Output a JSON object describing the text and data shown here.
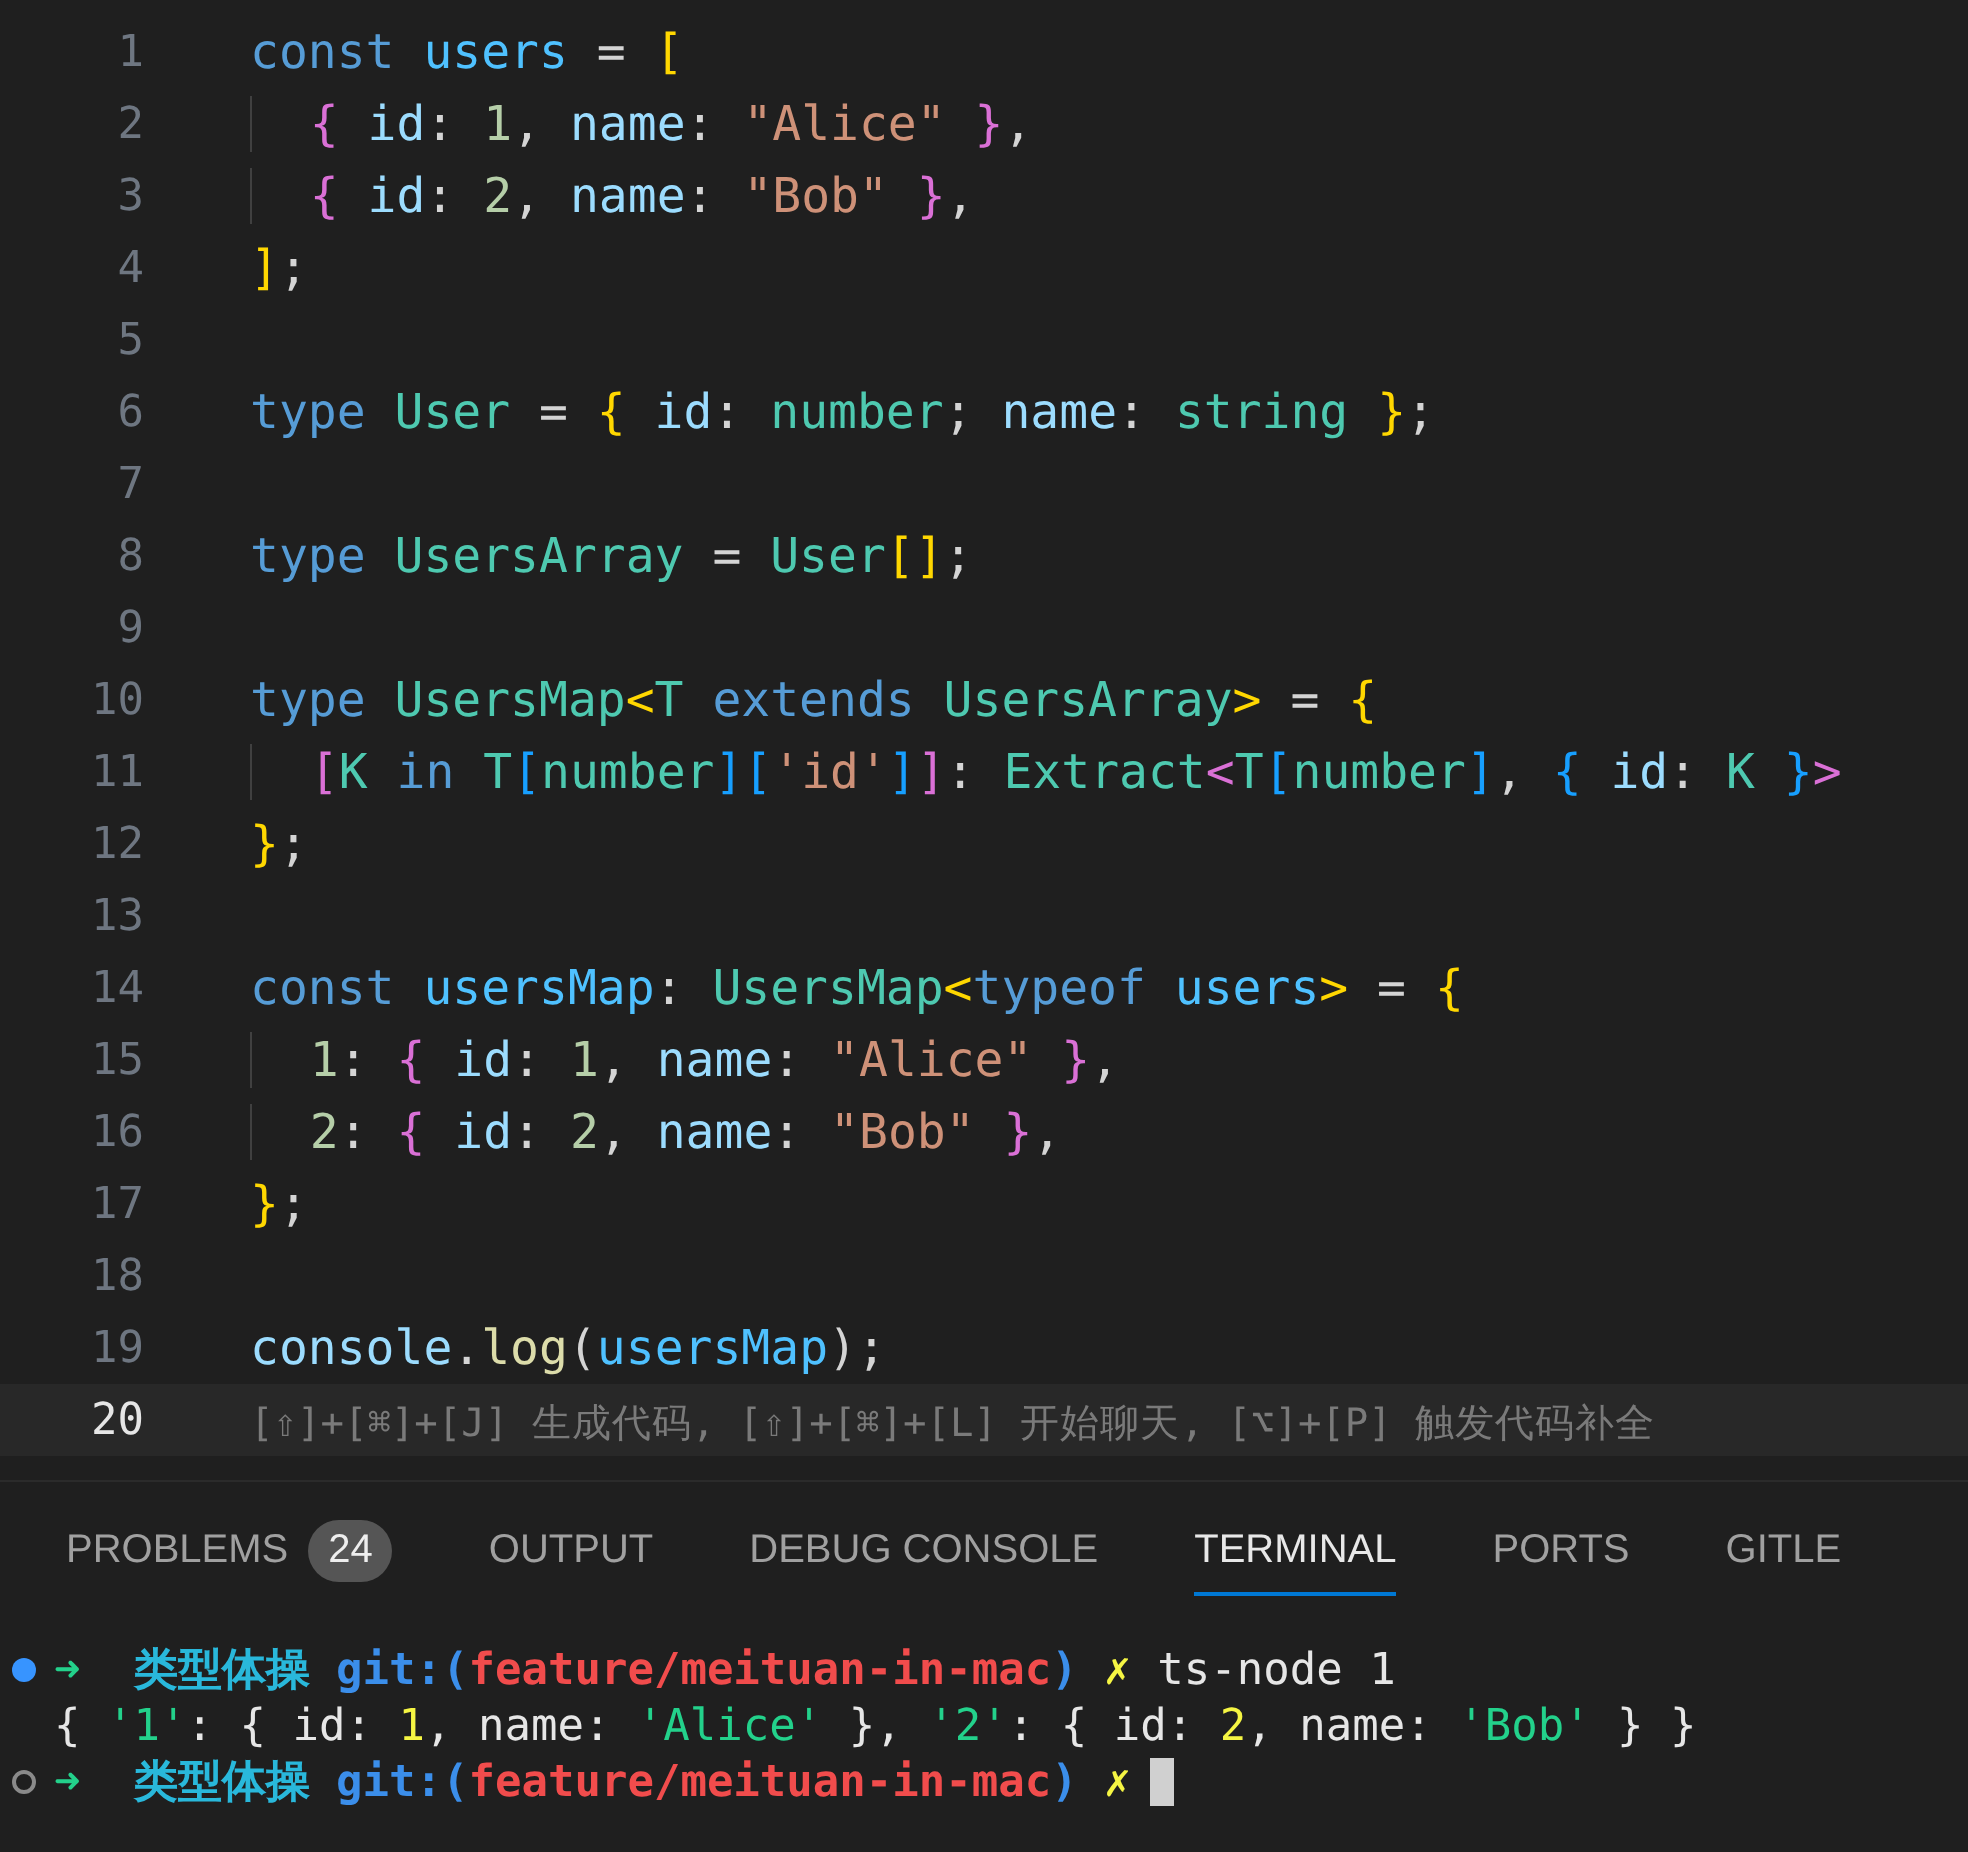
{
  "editor": {
    "lines": [
      {
        "number": "1",
        "current": false,
        "tokens": [
          {
            "text": "const ",
            "kind": "kw"
          },
          {
            "text": "users",
            "kind": "var"
          },
          {
            "text": " = ",
            "kind": "p"
          },
          {
            "text": "[",
            "kind": "b1"
          }
        ]
      },
      {
        "number": "2",
        "current": false,
        "guide": true,
        "tokens": [
          {
            "text": "{",
            "kind": "b2"
          },
          {
            "text": " id",
            "kind": "prop"
          },
          {
            "text": ": ",
            "kind": "p"
          },
          {
            "text": "1",
            "kind": "num"
          },
          {
            "text": ", ",
            "kind": "p"
          },
          {
            "text": "name",
            "kind": "prop"
          },
          {
            "text": ": ",
            "kind": "p"
          },
          {
            "text": "\"Alice\"",
            "kind": "str"
          },
          {
            "text": " }",
            "kind": "b2"
          },
          {
            "text": ",",
            "kind": "p"
          }
        ]
      },
      {
        "number": "3",
        "current": false,
        "guide": true,
        "tokens": [
          {
            "text": "{",
            "kind": "b2"
          },
          {
            "text": " id",
            "kind": "prop"
          },
          {
            "text": ": ",
            "kind": "p"
          },
          {
            "text": "2",
            "kind": "num"
          },
          {
            "text": ", ",
            "kind": "p"
          },
          {
            "text": "name",
            "kind": "prop"
          },
          {
            "text": ": ",
            "kind": "p"
          },
          {
            "text": "\"Bob\"",
            "kind": "str"
          },
          {
            "text": " }",
            "kind": "b2"
          },
          {
            "text": ",",
            "kind": "p"
          }
        ]
      },
      {
        "number": "4",
        "current": false,
        "tokens": [
          {
            "text": "]",
            "kind": "b1"
          },
          {
            "text": ";",
            "kind": "p"
          }
        ]
      },
      {
        "number": "5",
        "current": false
      },
      {
        "number": "6",
        "current": false,
        "tokens": [
          {
            "text": "type ",
            "kind": "kw"
          },
          {
            "text": "User",
            "kind": "type"
          },
          {
            "text": " = ",
            "kind": "p"
          },
          {
            "text": "{",
            "kind": "b1"
          },
          {
            "text": " id",
            "kind": "prop"
          },
          {
            "text": ": ",
            "kind": "p"
          },
          {
            "text": "number",
            "kind": "type"
          },
          {
            "text": "; ",
            "kind": "p"
          },
          {
            "text": "name",
            "kind": "prop"
          },
          {
            "text": ": ",
            "kind": "p"
          },
          {
            "text": "string",
            "kind": "type"
          },
          {
            "text": " }",
            "kind": "b1"
          },
          {
            "text": ";",
            "kind": "p"
          }
        ]
      },
      {
        "number": "7",
        "current": false
      },
      {
        "number": "8",
        "current": false,
        "tokens": [
          {
            "text": "type ",
            "kind": "kw"
          },
          {
            "text": "UsersArray",
            "kind": "type"
          },
          {
            "text": " = ",
            "kind": "p"
          },
          {
            "text": "User",
            "kind": "type"
          },
          {
            "text": "[]",
            "kind": "b1"
          },
          {
            "text": ";",
            "kind": "p"
          }
        ]
      },
      {
        "number": "9",
        "current": false
      },
      {
        "number": "10",
        "current": false,
        "tokens": [
          {
            "text": "type ",
            "kind": "kw"
          },
          {
            "text": "UsersMap",
            "kind": "type"
          },
          {
            "text": "<",
            "kind": "b1"
          },
          {
            "text": "T",
            "kind": "type"
          },
          {
            "text": " extends ",
            "kind": "kw"
          },
          {
            "text": "UsersArray",
            "kind": "type"
          },
          {
            "text": ">",
            "kind": "b1"
          },
          {
            "text": " = ",
            "kind": "p"
          },
          {
            "text": "{",
            "kind": "b1"
          }
        ]
      },
      {
        "number": "11",
        "current": false,
        "guide": true,
        "tokens": [
          {
            "text": "[",
            "kind": "b2"
          },
          {
            "text": "K",
            "kind": "type"
          },
          {
            "text": " in ",
            "kind": "kw"
          },
          {
            "text": "T",
            "kind": "type"
          },
          {
            "text": "[",
            "kind": "b3"
          },
          {
            "text": "number",
            "kind": "type"
          },
          {
            "text": "]",
            "kind": "b3"
          },
          {
            "text": "[",
            "kind": "b3"
          },
          {
            "text": "'id'",
            "kind": "str"
          },
          {
            "text": "]",
            "kind": "b3"
          },
          {
            "text": "]",
            "kind": "b2"
          },
          {
            "text": ": ",
            "kind": "p"
          },
          {
            "text": "Extract",
            "kind": "type"
          },
          {
            "text": "<",
            "kind": "b2"
          },
          {
            "text": "T",
            "kind": "type"
          },
          {
            "text": "[",
            "kind": "b3"
          },
          {
            "text": "number",
            "kind": "type"
          },
          {
            "text": "]",
            "kind": "b3"
          },
          {
            "text": ", ",
            "kind": "p"
          },
          {
            "text": "{",
            "kind": "b3"
          },
          {
            "text": " id",
            "kind": "prop"
          },
          {
            "text": ": ",
            "kind": "p"
          },
          {
            "text": "K",
            "kind": "type"
          },
          {
            "text": " }",
            "kind": "b3"
          },
          {
            "text": ">",
            "kind": "b2"
          }
        ]
      },
      {
        "number": "12",
        "current": false,
        "tokens": [
          {
            "text": "}",
            "kind": "b1"
          },
          {
            "text": ";",
            "kind": "p"
          }
        ]
      },
      {
        "number": "13",
        "current": false
      },
      {
        "number": "14",
        "current": false,
        "tokens": [
          {
            "text": "const ",
            "kind": "kw"
          },
          {
            "text": "usersMap",
            "kind": "var"
          },
          {
            "text": ": ",
            "kind": "p"
          },
          {
            "text": "UsersMap",
            "kind": "type"
          },
          {
            "text": "<",
            "kind": "b1"
          },
          {
            "text": "typeof ",
            "kind": "kw"
          },
          {
            "text": "users",
            "kind": "var"
          },
          {
            "text": ">",
            "kind": "b1"
          },
          {
            "text": " = ",
            "kind": "p"
          },
          {
            "text": "{",
            "kind": "b1"
          }
        ]
      },
      {
        "number": "15",
        "current": false,
        "guide": true,
        "tokens": [
          {
            "text": "1",
            "kind": "num"
          },
          {
            "text": ": ",
            "kind": "p"
          },
          {
            "text": "{",
            "kind": "b2"
          },
          {
            "text": " id",
            "kind": "prop"
          },
          {
            "text": ": ",
            "kind": "p"
          },
          {
            "text": "1",
            "kind": "num"
          },
          {
            "text": ", ",
            "kind": "p"
          },
          {
            "text": "name",
            "kind": "prop"
          },
          {
            "text": ": ",
            "kind": "p"
          },
          {
            "text": "\"Alice\"",
            "kind": "str"
          },
          {
            "text": " }",
            "kind": "b2"
          },
          {
            "text": ",",
            "kind": "p"
          }
        ]
      },
      {
        "number": "16",
        "current": false,
        "guide": true,
        "tokens": [
          {
            "text": "2",
            "kind": "num"
          },
          {
            "text": ": ",
            "kind": "p"
          },
          {
            "text": "{",
            "kind": "b2"
          },
          {
            "text": " id",
            "kind": "prop"
          },
          {
            "text": ": ",
            "kind": "p"
          },
          {
            "text": "2",
            "kind": "num"
          },
          {
            "text": ", ",
            "kind": "p"
          },
          {
            "text": "name",
            "kind": "prop"
          },
          {
            "text": ": ",
            "kind": "p"
          },
          {
            "text": "\"Bob\"",
            "kind": "str"
          },
          {
            "text": " }",
            "kind": "b2"
          },
          {
            "text": ",",
            "kind": "p"
          }
        ]
      },
      {
        "number": "17",
        "current": false,
        "tokens": [
          {
            "text": "}",
            "kind": "b1"
          },
          {
            "text": ";",
            "kind": "p"
          }
        ]
      },
      {
        "number": "18",
        "current": false
      },
      {
        "number": "19",
        "current": false,
        "tokens": [
          {
            "text": "console",
            "kind": "prop"
          },
          {
            "text": ".",
            "kind": "p"
          },
          {
            "text": "log",
            "kind": "fn"
          },
          {
            "text": "(",
            "kind": "p"
          },
          {
            "text": "usersMap",
            "kind": "var"
          },
          {
            "text": ")",
            "kind": "p"
          },
          {
            "text": ";",
            "kind": "p"
          }
        ]
      },
      {
        "number": "20",
        "current": true,
        "tokens": [
          {
            "text": "[⇧]+[⌘]+[J] 生成代码, [⇧]+[⌘]+[L] 开始聊天, [⌥]+[P] 触发代码补全",
            "kind": "hint"
          }
        ]
      }
    ]
  },
  "panel": {
    "tabs": [
      {
        "label": "PROBLEMS",
        "selected": false,
        "badge": "24"
      },
      {
        "label": "OUTPUT",
        "selected": false
      },
      {
        "label": "DEBUG CONSOLE",
        "selected": false
      },
      {
        "label": "TERMINAL",
        "selected": true
      },
      {
        "label": "PORTS",
        "selected": false
      },
      {
        "label": "GITLE",
        "selected": false
      }
    ],
    "terminal": [
      {
        "kind": "prompt",
        "done": true,
        "cursor": false,
        "tokens": [
          {
            "text": "➜  ",
            "kind": "arrow"
          },
          {
            "text": "类型体操 ",
            "kind": "dir"
          },
          {
            "text": "git:(",
            "kind": "git"
          },
          {
            "text": "feature/meituan-in-mac",
            "kind": "branch"
          },
          {
            "text": ") ",
            "kind": "git"
          },
          {
            "text": "✗ ",
            "kind": "dirty"
          },
          {
            "text": "ts-node 1",
            "kind": "out"
          }
        ]
      },
      {
        "kind": "output",
        "cursor": false,
        "tokens": [
          {
            "text": "{ ",
            "kind": "out"
          },
          {
            "text": "'1'",
            "kind": "ostr"
          },
          {
            "text": ": { id: ",
            "kind": "out"
          },
          {
            "text": "1",
            "kind": "onum"
          },
          {
            "text": ", name: ",
            "kind": "out"
          },
          {
            "text": "'Alice'",
            "kind": "ostr"
          },
          {
            "text": " }, ",
            "kind": "out"
          },
          {
            "text": "'2'",
            "kind": "ostr"
          },
          {
            "text": ": { id: ",
            "kind": "out"
          },
          {
            "text": "2",
            "kind": "onum"
          },
          {
            "text": ", name: ",
            "kind": "out"
          },
          {
            "text": "'Bob'",
            "kind": "ostr"
          },
          {
            "text": " } }",
            "kind": "out"
          }
        ]
      },
      {
        "kind": "prompt",
        "done": false,
        "cursor": true,
        "tokens": [
          {
            "text": "➜  ",
            "kind": "arrow"
          },
          {
            "text": "类型体操 ",
            "kind": "dir"
          },
          {
            "text": "git:(",
            "kind": "git"
          },
          {
            "text": "feature/meituan-in-mac",
            "kind": "branch"
          },
          {
            "text": ") ",
            "kind": "git"
          },
          {
            "text": "✗",
            "kind": "dirty"
          }
        ]
      }
    ]
  }
}
